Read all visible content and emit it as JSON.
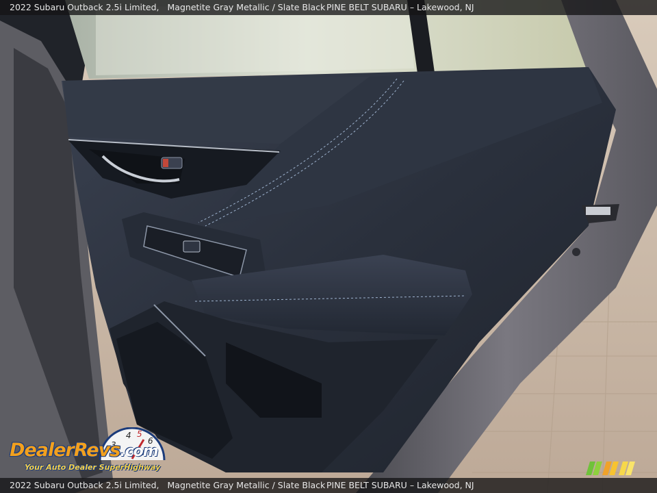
{
  "caption": {
    "vehicle": "2022 Subaru Outback 2.5i Limited,",
    "colors": "Magnetite Gray Metallic / Slate Black",
    "dealer": "PINE BELT SUBARU",
    "separator": "–",
    "location": "Lakewood, NJ"
  },
  "watermark": {
    "brand_left": "Dealer",
    "brand_right": "Revs",
    "brand_suffix": ".com",
    "tagline": "Your Auto Dealer SuperHighway",
    "gauge_digits": [
      "3",
      "4",
      "5",
      "6"
    ]
  },
  "colors": {
    "door_panel": "#2b3240",
    "door_frame": "#6b6a70",
    "stitching": "#9fb4d0",
    "pavement": "#c9b8a6",
    "logo_orange": "#f2a01e",
    "logo_navy": "#1b3b7a"
  }
}
